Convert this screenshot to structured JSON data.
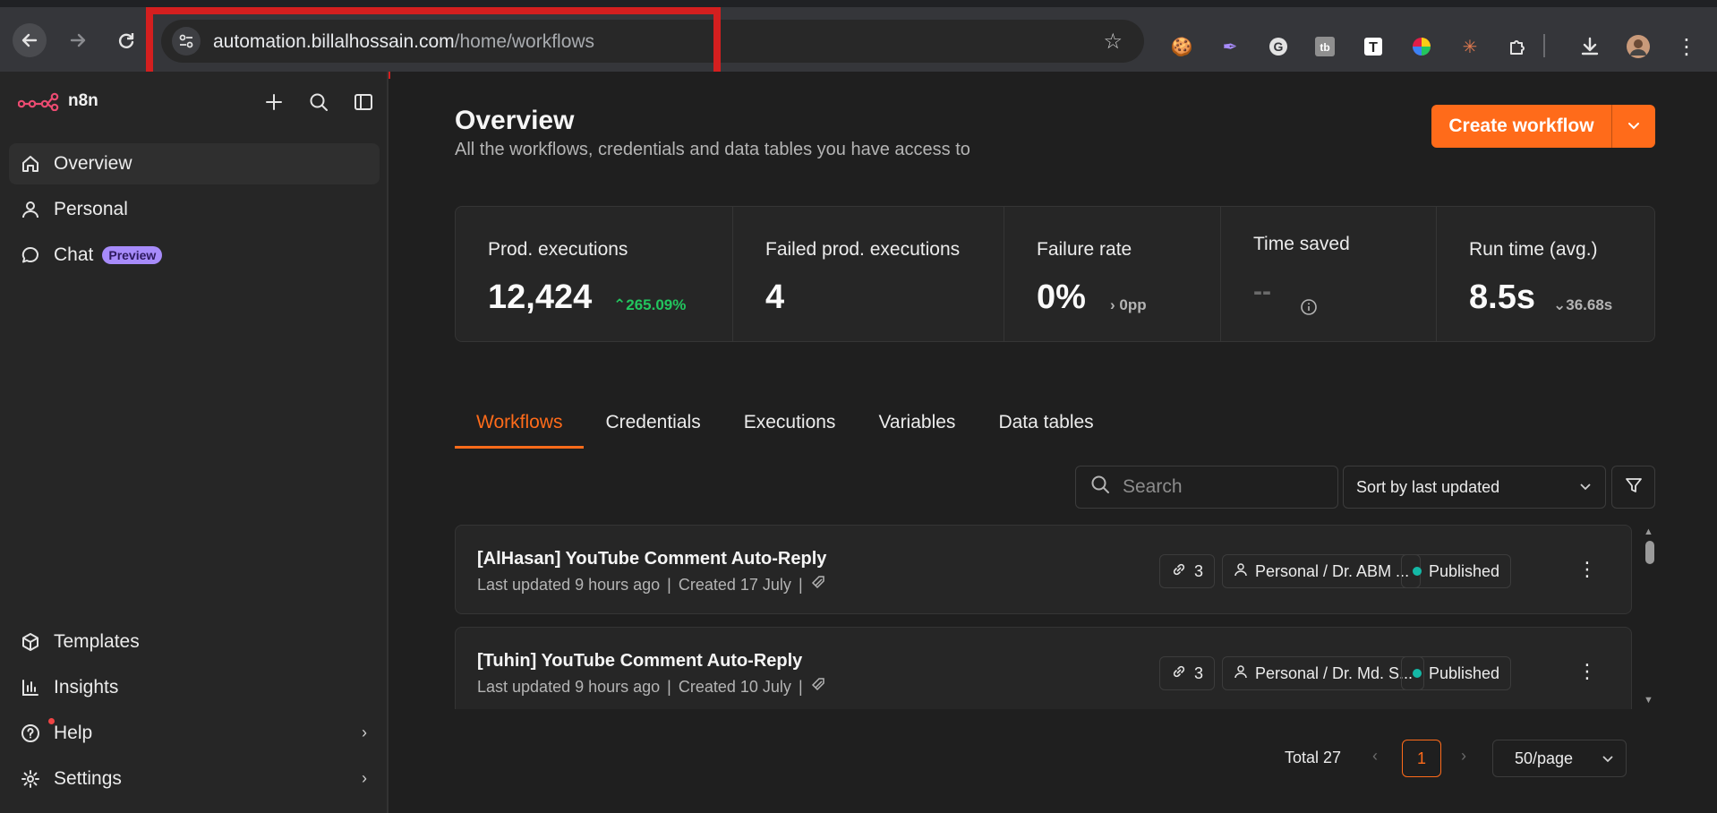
{
  "browser": {
    "url_host": "automation.billalhossain.com",
    "url_path": "/home/workflows",
    "icons": [
      "back-arrow-icon",
      "forward-arrow-icon",
      "reload-icon",
      "site-info-icon",
      "bookmark-star-icon",
      "cookie-extension-icon",
      "feather-extension-icon",
      "grammarly-extension-icon",
      "tb-extension-icon",
      "t-extension-icon",
      "color-wheel-extension-icon",
      "claude-extension-icon",
      "extensions-puzzle-icon",
      "download-icon",
      "profile-avatar-icon",
      "chrome-menu-icon"
    ],
    "highlight_color": "#d41f1f"
  },
  "sidebar": {
    "app_name": "n8n",
    "nav": [
      {
        "label": "Overview",
        "icon": "home-icon"
      },
      {
        "label": "Personal",
        "icon": "user-icon"
      },
      {
        "label": "Chat",
        "icon": "chat-icon",
        "badge": "Preview"
      }
    ],
    "bottom": [
      {
        "label": "Templates",
        "icon": "box-icon"
      },
      {
        "label": "Insights",
        "icon": "bar-chart-icon"
      },
      {
        "label": "Help",
        "icon": "help-icon"
      },
      {
        "label": "Settings",
        "icon": "gear-icon"
      }
    ]
  },
  "header": {
    "title": "Overview",
    "subtitle": "All the workflows, credentials and data tables you have access to",
    "create_label": "Create workflow"
  },
  "stats": [
    {
      "label": "Prod. executions",
      "value": "12,424",
      "delta": "265.09%",
      "delta_dir": "up"
    },
    {
      "label": "Failed prod. executions",
      "value": "4",
      "delta": ""
    },
    {
      "label": "Failure rate",
      "value": "0%",
      "delta": "0pp",
      "delta_dir": "right"
    },
    {
      "label": "Time saved",
      "value": "--",
      "delta": ""
    },
    {
      "label": "Run time (avg.)",
      "value": "8.5s",
      "delta": "36.68s",
      "delta_dir": "down"
    }
  ],
  "tabs": [
    "Workflows",
    "Credentials",
    "Executions",
    "Variables",
    "Data tables"
  ],
  "toolbar": {
    "search_placeholder": "Search",
    "sort_label": "Sort by last updated"
  },
  "workflows": [
    {
      "title": "[AlHasan] YouTube Comment Auto-Reply",
      "updated": "Last updated 9 hours ago",
      "created": "Created 17 July",
      "links": "3",
      "owner": "Personal / Dr. ABM ...",
      "status": "Published"
    },
    {
      "title": "[Tuhin] YouTube Comment Auto-Reply",
      "updated": "Last updated 9 hours ago",
      "created": "Created 10 July",
      "links": "3",
      "owner": "Personal / Dr. Md. S...",
      "status": "Published"
    }
  ],
  "pagination": {
    "total": "Total 27",
    "page": "1",
    "page_size": "50/page"
  },
  "colors": {
    "accent": "#ff6b1a",
    "success": "#22c55e",
    "published_dot": "#14b8a6",
    "preview_badge": "#a78bfa"
  }
}
